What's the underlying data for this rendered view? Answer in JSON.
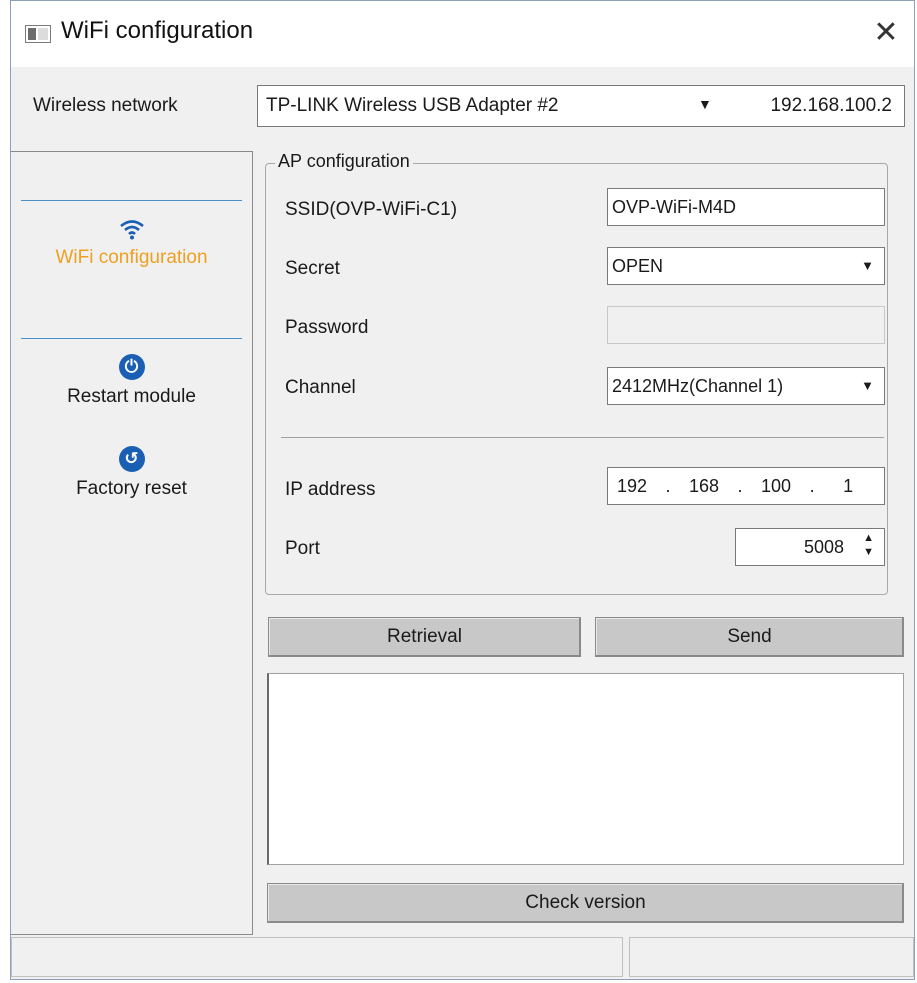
{
  "window": {
    "title": "WiFi configuration",
    "close_glyph": "✕"
  },
  "network": {
    "label": "Wireless network",
    "adapter": "TP-LINK Wireless USB Adapter #2",
    "ip": "192.168.100.2",
    "dropdown_glyph": "▼"
  },
  "sidebar": {
    "items": [
      {
        "label": "WiFi configuration",
        "icon": "wifi-icon",
        "active": true,
        "color": "#f0a020"
      },
      {
        "label": "Restart module",
        "icon": "power-icon",
        "icon_glyph": "⏻"
      },
      {
        "label": "Factory reset",
        "icon": "reset-icon",
        "icon_glyph": "↺"
      }
    ]
  },
  "ap": {
    "group_title": "AP configuration",
    "ssid_label": "SSID(OVP-WiFi-C1)",
    "ssid_value": "OVP-WiFi-M4D",
    "secret_label": "Secret",
    "secret_value": "OPEN",
    "password_label": "Password",
    "password_value": "",
    "channel_label": "Channel",
    "channel_value": "2412MHz(Channel 1)",
    "ip_label": "IP address",
    "ip_octets": [
      "192",
      "168",
      "100",
      "1"
    ],
    "ip_dot": ".",
    "port_label": "Port",
    "port_value": "5008",
    "spin_up": "▲",
    "spin_down": "▼",
    "dropdown_glyph": "▼"
  },
  "buttons": {
    "retrieval": "Retrieval",
    "send": "Send",
    "check_version": "Check version"
  },
  "log": {
    "text": ""
  },
  "status": {
    "left": "",
    "right": ""
  },
  "colors": {
    "accent": "#f0a020",
    "icon_blue": "#1b5fb4",
    "divider": "#4a90c8"
  }
}
